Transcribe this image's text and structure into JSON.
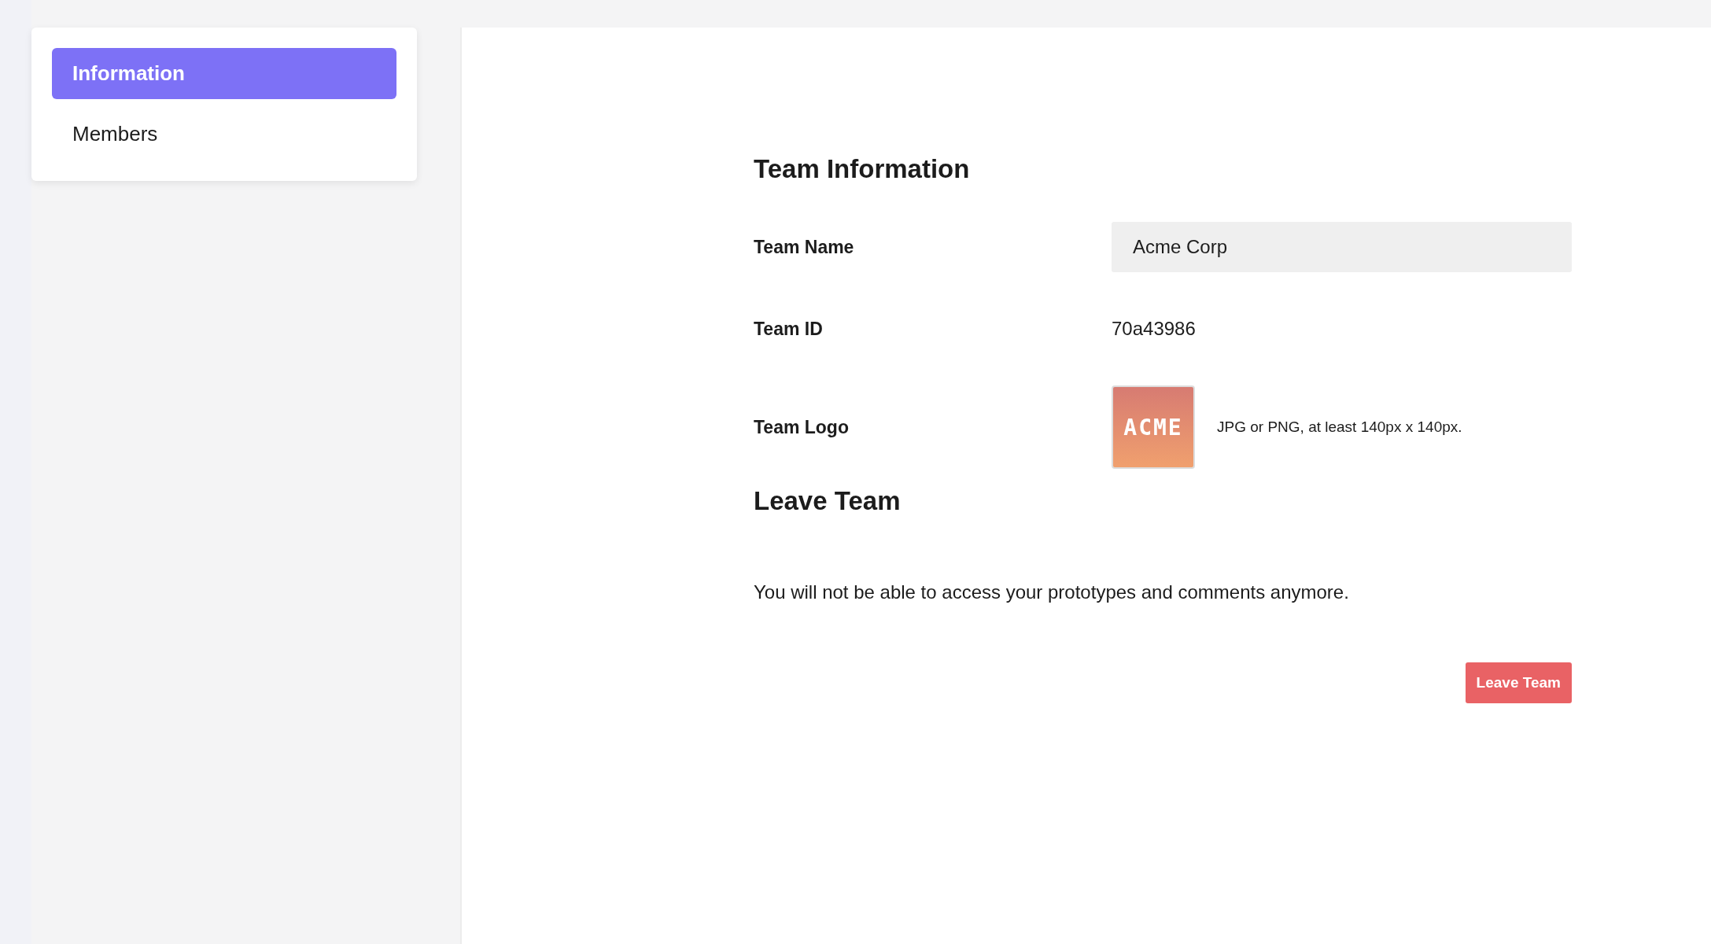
{
  "sidebar": {
    "items": [
      {
        "label": "Information",
        "selected": true
      },
      {
        "label": "Members",
        "selected": false
      }
    ]
  },
  "team_information": {
    "title": "Team Information",
    "fields": [
      {
        "kind": "input",
        "label": "Team Name",
        "value": "Acme Corp"
      },
      {
        "kind": "text",
        "label": "Team ID",
        "value": "70a43986"
      },
      {
        "kind": "logo",
        "label": "Team Logo",
        "value": "ACME",
        "hint": "JPG or PNG, at least 140px x 140px."
      }
    ]
  },
  "leave_team": {
    "title": "Leave Team",
    "description": "You will not be able to access your prototypes and comments anymore.",
    "button": "Leave Team"
  }
}
